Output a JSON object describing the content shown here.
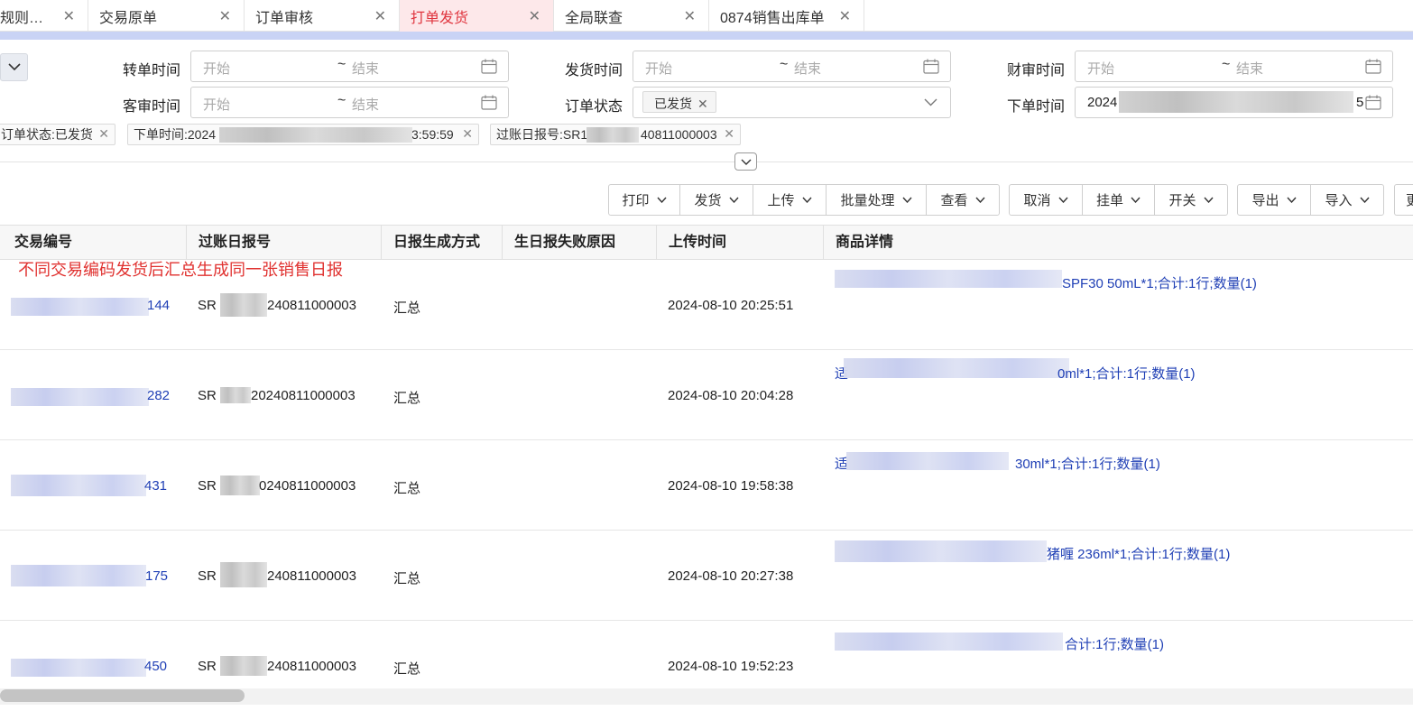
{
  "tabs": [
    {
      "label": "规则…",
      "active": false,
      "closable": true
    },
    {
      "label": "交易原单",
      "active": false,
      "closable": true
    },
    {
      "label": "订单审核",
      "active": false,
      "closable": true
    },
    {
      "label": "打单发货",
      "active": true,
      "closable": true
    },
    {
      "label": "全局联查",
      "active": false,
      "closable": true
    },
    {
      "label": "0874销售出库单",
      "active": false,
      "closable": true
    }
  ],
  "filters": {
    "zhuandan_label": "转单时间",
    "fahuo_label": "发货时间",
    "caishen_label": "财审时间",
    "keshen_label": "客审时间",
    "status_label": "订单状态",
    "xiadan_label": "下单时间",
    "start_placeholder": "开始",
    "end_placeholder": "结束",
    "tilde": "~",
    "status_tag": "已发货",
    "xiadan_value_prefix": "2024",
    "xiadan_value_suffix": "5"
  },
  "chips": [
    {
      "text": "订单状态:已发货"
    },
    {
      "text": "下单时间:2024",
      "suffix": "3:59:59"
    },
    {
      "text": "过账日报号:SR1",
      "suffix": "40811000003"
    }
  ],
  "toolbar": [
    {
      "label": "打印"
    },
    {
      "label": "发货"
    },
    {
      "label": "上传"
    },
    {
      "label": "批量处理"
    },
    {
      "label": "查看"
    },
    {
      "label": "取消"
    },
    {
      "label": "挂单"
    },
    {
      "label": "开关"
    },
    {
      "label": "导出"
    },
    {
      "label": "导入"
    },
    {
      "label": "更"
    }
  ],
  "table": {
    "columns": [
      "交易编号",
      "过账日报号",
      "日报生成方式",
      "生日报失败原因",
      "上传时间",
      "商品详情"
    ],
    "annotation": "不同交易编码发货后汇总生成同一张销售日报",
    "rows": [
      {
        "trade_suffix": "144",
        "report_prefix": "SR",
        "report_suffix": "240811000003",
        "method": "汇总",
        "fail_reason": "",
        "upload_time": "2024-08-10 20:25:51",
        "detail": "SPF30 50mL*1;合计:1行;数量(1)"
      },
      {
        "trade_suffix": "282",
        "report_prefix": "SR",
        "report_suffix": "20240811000003",
        "method": "汇总",
        "fail_reason": "",
        "upload_time": "2024-08-10 20:04:28",
        "detail": "0ml*1;合计:1行;数量(1)",
        "detail_lead": "适"
      },
      {
        "trade_suffix": "431",
        "report_prefix": "SR",
        "report_suffix": "0240811000003",
        "method": "汇总",
        "fail_reason": "",
        "upload_time": "2024-08-10 19:58:38",
        "detail": "30ml*1;合计:1行;数量(1)",
        "detail_lead": "适"
      },
      {
        "trade_suffix": "175",
        "report_prefix": "SR",
        "report_suffix": "240811000003",
        "method": "汇总",
        "fail_reason": "",
        "upload_time": "2024-08-10 20:27:38",
        "detail": "猪喱  236ml*1;合计:1行;数量(1)"
      },
      {
        "trade_suffix": "450",
        "report_prefix": "SR",
        "report_suffix": "240811000003",
        "method": "汇总",
        "fail_reason": "",
        "upload_time": "2024-08-10 19:52:23",
        "detail": "合计:1行;数量(1)"
      }
    ]
  },
  "colors": {
    "accent": "#e0353f",
    "link": "#1f3fb5",
    "band": "#c9d3f5",
    "annotation": "#e0312f"
  },
  "icons": [
    "close-icon",
    "calendar-icon",
    "chevron-down-icon",
    "collapse-icon",
    "expand-icon"
  ]
}
